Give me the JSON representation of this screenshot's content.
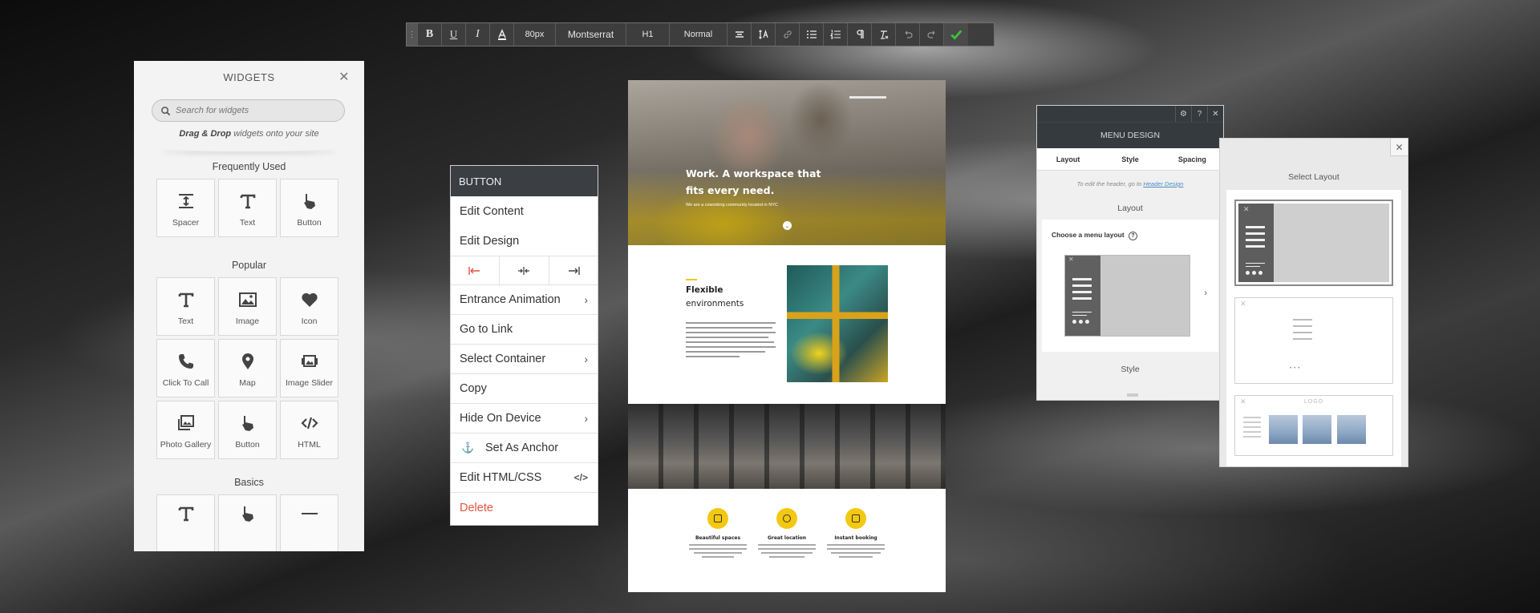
{
  "toolbar": {
    "grip": "⋮",
    "font_size": "80px",
    "font_family": "Montserrat",
    "heading": "H1",
    "weight": "Normal",
    "bold_label": "B",
    "underline_label": "U",
    "italic_label": "I"
  },
  "widgets": {
    "title": "WIDGETS",
    "close": "✕",
    "search_placeholder": "Search for widgets",
    "hint_bold": "Drag & Drop",
    "hint_rest": " widgets onto your site",
    "sections": {
      "frequent": "Frequently Used",
      "popular": "Popular",
      "basics": "Basics"
    },
    "frequent": [
      "Spacer",
      "Text",
      "Button"
    ],
    "popular": [
      "Text",
      "Image",
      "Icon",
      "Click To Call",
      "Map",
      "Image Slider",
      "Photo Gallery",
      "Button",
      "HTML"
    ]
  },
  "context_menu": {
    "title": "BUTTON",
    "items": {
      "edit_content": "Edit Content",
      "edit_design": "Edit Design",
      "entrance_animation": "Entrance Animation",
      "go_to_link": "Go to Link",
      "select_container": "Select Container",
      "copy": "Copy",
      "hide_on_device": "Hide On Device",
      "set_as_anchor": "Set As Anchor",
      "edit_html_css": "Edit HTML/CSS",
      "delete": "Delete"
    },
    "chevron": "›",
    "code_glyph": "</>",
    "anchor_glyph": "⚓"
  },
  "site": {
    "hero_title": "Work. A workspace that fits every need.",
    "hero_sub": "We are a coworking community located in NYC",
    "hero_dot": "⌄",
    "flex_title_1": "Flexible",
    "flex_title_2": "environments",
    "features": [
      {
        "title": "Beautiful spaces"
      },
      {
        "title": "Great location"
      },
      {
        "title": "Instant booking"
      }
    ]
  },
  "menu_design": {
    "icons": [
      "⚙",
      "?",
      "✕"
    ],
    "title": "MENU DESIGN",
    "tabs": [
      "Layout",
      "Style",
      "Spacing"
    ],
    "note_prefix": "To edit the header, go to ",
    "note_link": "Header Design",
    "layout_heading": "Layout",
    "choose_label": "Choose a menu layout",
    "help_icon": "?",
    "arrow": "›",
    "style_heading": "Style"
  },
  "select_layout": {
    "close": "✕",
    "title": "Select Layout",
    "card_x": "✕",
    "logo_text": "LOGO"
  },
  "colors": {
    "accent_yellow": "#f2c811",
    "delete_red": "#e0533f",
    "confirm_green": "#3ec13e",
    "panel_dark": "#3b3f44"
  }
}
